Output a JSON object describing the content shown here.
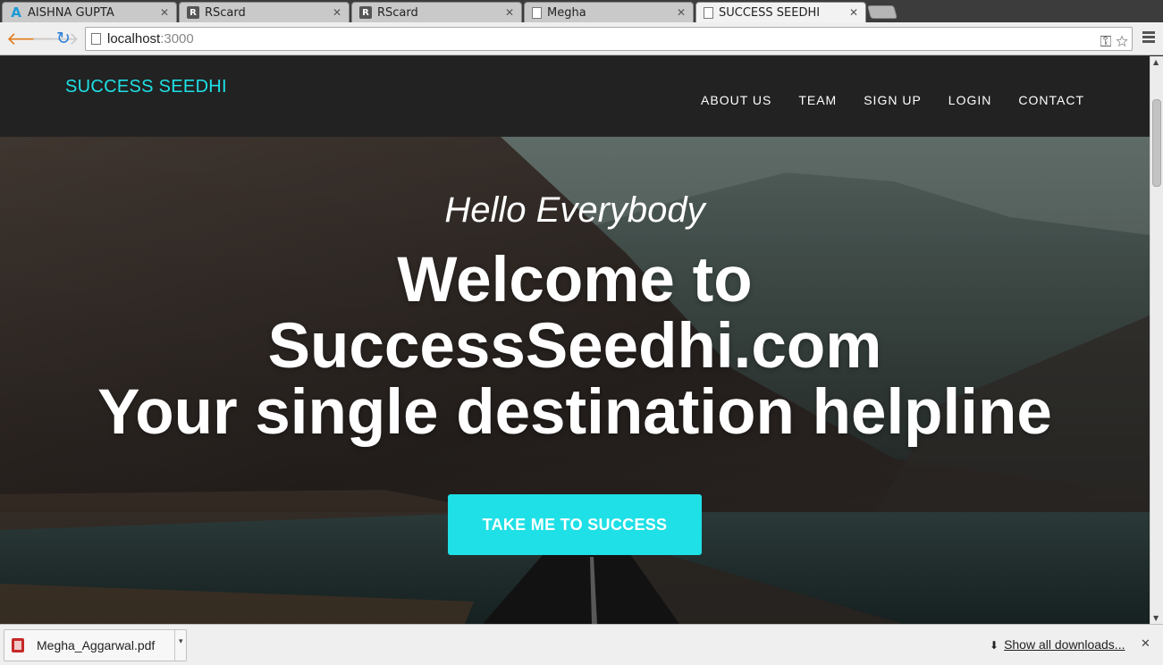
{
  "browser": {
    "tabs": [
      {
        "title": "AISHNA GUPTA",
        "favicon": "a-logo-icon",
        "active": false
      },
      {
        "title": "RScard",
        "favicon": "r-logo-icon",
        "active": false
      },
      {
        "title": "RScard",
        "favicon": "r-logo-icon",
        "active": false
      },
      {
        "title": "Megha",
        "favicon": "page-icon",
        "active": false
      },
      {
        "title": "SUCCESS SEEDHI",
        "favicon": "page-icon",
        "active": true
      }
    ],
    "url_host": "localhost",
    "url_port": ":3000"
  },
  "site": {
    "brand": "SUCCESS SEEDHI",
    "nav": [
      "ABOUT US",
      "TEAM",
      "SIGN UP",
      "LOGIN",
      "CONTACT"
    ],
    "hero": {
      "greeting": "Hello Everybody",
      "title_line1": "Welcome to",
      "title_line2": "SuccessSeedhi.com",
      "title_line3": "Your single destination helpline",
      "cta": "TAKE ME TO SUCCESS"
    },
    "colors": {
      "accent": "#1ee0e6",
      "navbar": "#222222"
    }
  },
  "downloads": {
    "file_name": "Megha_Aggarwal.pdf",
    "show_all": "Show all downloads..."
  }
}
